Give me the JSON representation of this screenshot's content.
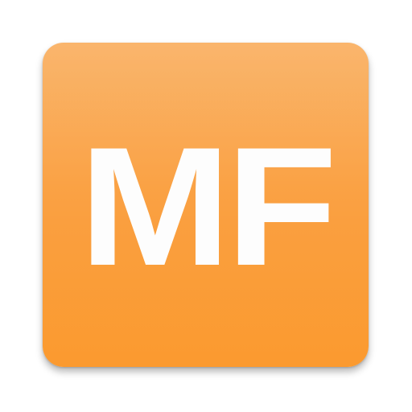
{
  "icon": {
    "monogram": "MF",
    "background_top": "#f9ad5c",
    "background_bottom": "#fb9a2f",
    "text_color": "#fdfdfd"
  }
}
